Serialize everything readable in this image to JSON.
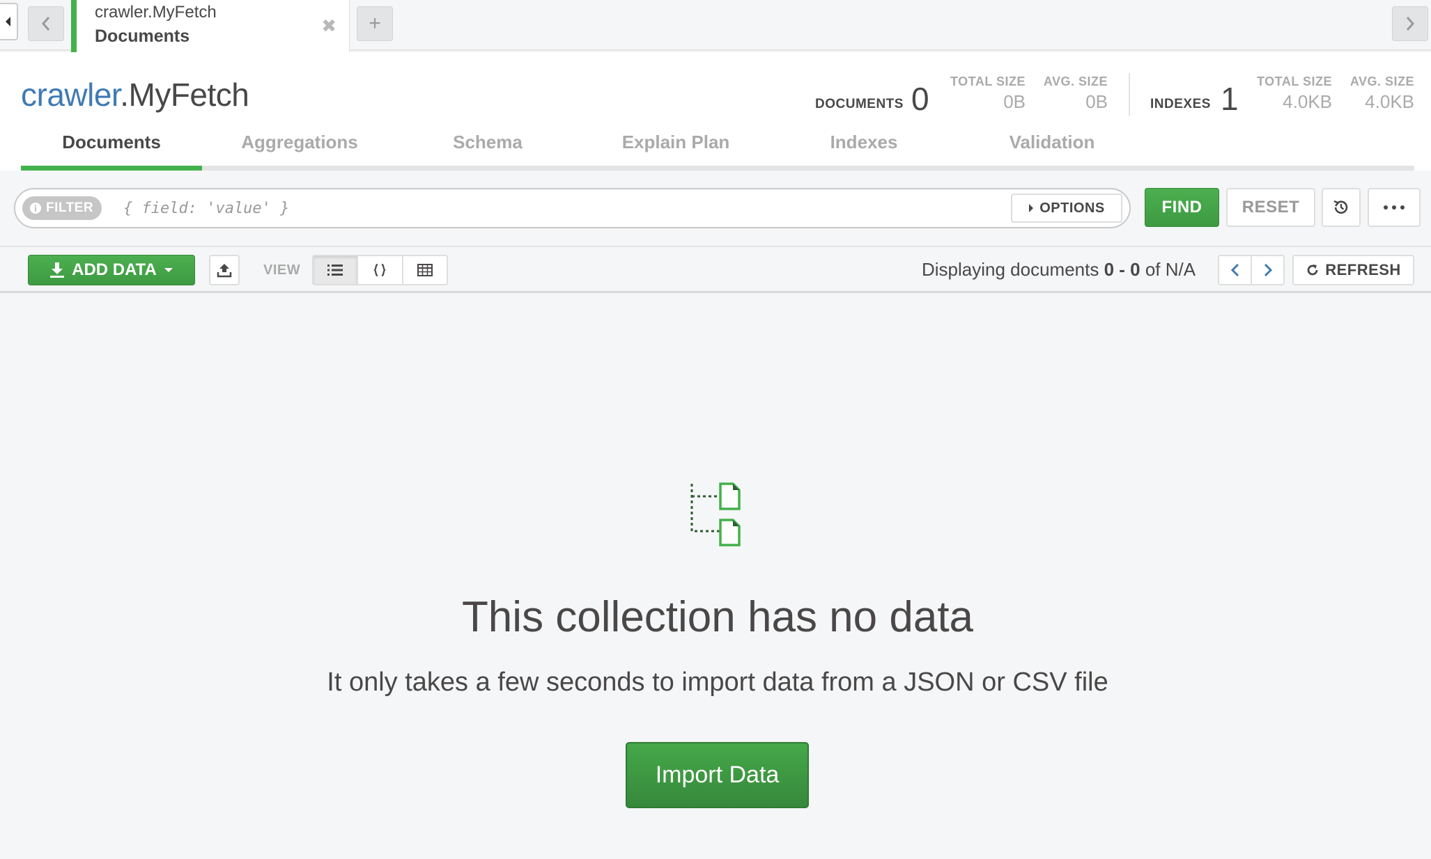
{
  "tab": {
    "namespace": "crawler.MyFetch",
    "subtitle": "Documents",
    "close_glyph": "✖",
    "new_tab_glyph": "+"
  },
  "collection": {
    "db": "crawler",
    "name": ".MyFetch"
  },
  "stats": {
    "documents_label": "DOCUMENTS",
    "documents_count": "0",
    "doc_total_size_label": "TOTAL SIZE",
    "doc_total_size": "0B",
    "doc_avg_size_label": "AVG. SIZE",
    "doc_avg_size": "0B",
    "indexes_label": "INDEXES",
    "indexes_count": "1",
    "idx_total_size_label": "TOTAL SIZE",
    "idx_total_size": "4.0KB",
    "idx_avg_size_label": "AVG. SIZE",
    "idx_avg_size": "4.0KB"
  },
  "tabs": [
    "Documents",
    "Aggregations",
    "Schema",
    "Explain Plan",
    "Indexes",
    "Validation"
  ],
  "query": {
    "filter_label": "FILTER",
    "filter_placeholder": "{ field: 'value' }",
    "options_label": "OPTIONS",
    "find_label": "FIND",
    "reset_label": "RESET"
  },
  "toolbar": {
    "add_data_label": "ADD DATA",
    "view_label": "VIEW",
    "display_prefix": "Displaying documents ",
    "display_range": "0 - 0",
    "display_suffix": " of N/A",
    "refresh_label": "REFRESH"
  },
  "empty": {
    "title": "This collection has no data",
    "subtitle": "It only takes a few seconds to import data from a JSON or CSV file",
    "import_label": "Import Data"
  },
  "colors": {
    "accent_green": "#43b14c",
    "db_blue": "#3f7ab5",
    "text_dark": "#494747",
    "text_muted": "#aaaaaa"
  },
  "icons": [
    "caret-left-icon",
    "chevron-left-icon",
    "chevron-right-icon",
    "info-icon",
    "caret-right-icon",
    "history-icon",
    "ellipsis-icon",
    "download-icon",
    "caret-down-icon",
    "export-icon",
    "list-view-icon",
    "json-view-icon",
    "table-view-icon",
    "refresh-icon",
    "empty-documents-icon"
  ]
}
